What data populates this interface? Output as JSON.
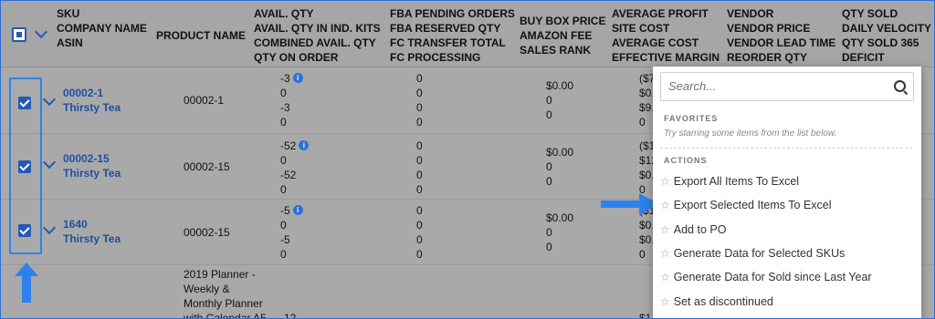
{
  "columns": [
    {
      "lines": [
        "SKU",
        "COMPANY NAME",
        "ASIN"
      ]
    },
    {
      "lines": [
        "PRODUCT NAME"
      ]
    },
    {
      "lines": [
        "AVAIL. QTY",
        "AVAIL. QTY IN IND. KITS",
        "COMBINED AVAIL. QTY",
        "QTY ON ORDER"
      ]
    },
    {
      "lines": [
        "FBA PENDING ORDERS",
        "FBA RESERVED QTY",
        "FC TRANSFER TOTAL",
        "FC PROCESSING"
      ]
    },
    {
      "lines": [
        "BUY BOX PRICE",
        "AMAZON FEE",
        "SALES RANK"
      ]
    },
    {
      "lines": [
        "AVERAGE PROFIT",
        "SITE COST",
        "AVERAGE COST",
        "EFFECTIVE MARGIN"
      ]
    },
    {
      "lines": [
        "VENDOR",
        "VENDOR PRICE",
        "VENDOR LEAD TIME",
        "REORDER QTY"
      ]
    },
    {
      "lines": [
        "QTY SOLD",
        "DAILY VELOCITY",
        "QTY SOLD 365",
        "DEFICIT"
      ]
    }
  ],
  "rows": [
    {
      "sku": "00002-1",
      "company": "Thirsty Tea",
      "product": "00002-1",
      "avail": [
        "-3",
        "0",
        "-3",
        "0"
      ],
      "fba": [
        "0",
        "0",
        "0",
        "0"
      ],
      "buybox": [
        "$0.00",
        "0",
        "0"
      ],
      "profit": [
        "($7",
        "$0.",
        "$9.",
        "0"
      ]
    },
    {
      "sku": "00002-15",
      "company": "Thirsty Tea",
      "product": "00002-15",
      "avail": [
        "-52",
        "0",
        "-52",
        "0"
      ],
      "fba": [
        "0",
        "0",
        "0",
        "0"
      ],
      "buybox": [
        "$0.00",
        "0",
        "0"
      ],
      "profit": [
        "($1",
        "$12",
        "$0.",
        "0"
      ]
    },
    {
      "sku": "1640",
      "company": "Thirsty Tea",
      "product": "00002-15",
      "avail": [
        "-5",
        "0",
        "-5",
        "0"
      ],
      "fba": [
        "0",
        "0",
        "0",
        "0"
      ],
      "buybox": [
        "$0.00",
        "0",
        "0"
      ],
      "profit": [
        "($1",
        "$0.",
        "$0.",
        "0"
      ]
    }
  ],
  "partial_row": {
    "product": [
      "2019 Planner -",
      "Weekly &",
      "Monthly Planner",
      "with Calendar A5"
    ],
    "avail": "-12",
    "profit": "$1"
  },
  "menu": {
    "search_placeholder": "Search...",
    "favorites_title": "FAVORITES",
    "favorites_note": "Try starring some items from the list below.",
    "actions_title": "ACTIONS",
    "star_glyph": "☆",
    "items": [
      "Export All Items To Excel",
      "Export Selected Items To Excel",
      "Add to PO",
      "Generate Data for Selected SKUs",
      "Generate Data for Sold since Last Year",
      "Set as discontinued"
    ]
  },
  "colors": {
    "accent": "#2f80ed",
    "link": "#1f4fa0",
    "checkbox": "#2459b8"
  }
}
